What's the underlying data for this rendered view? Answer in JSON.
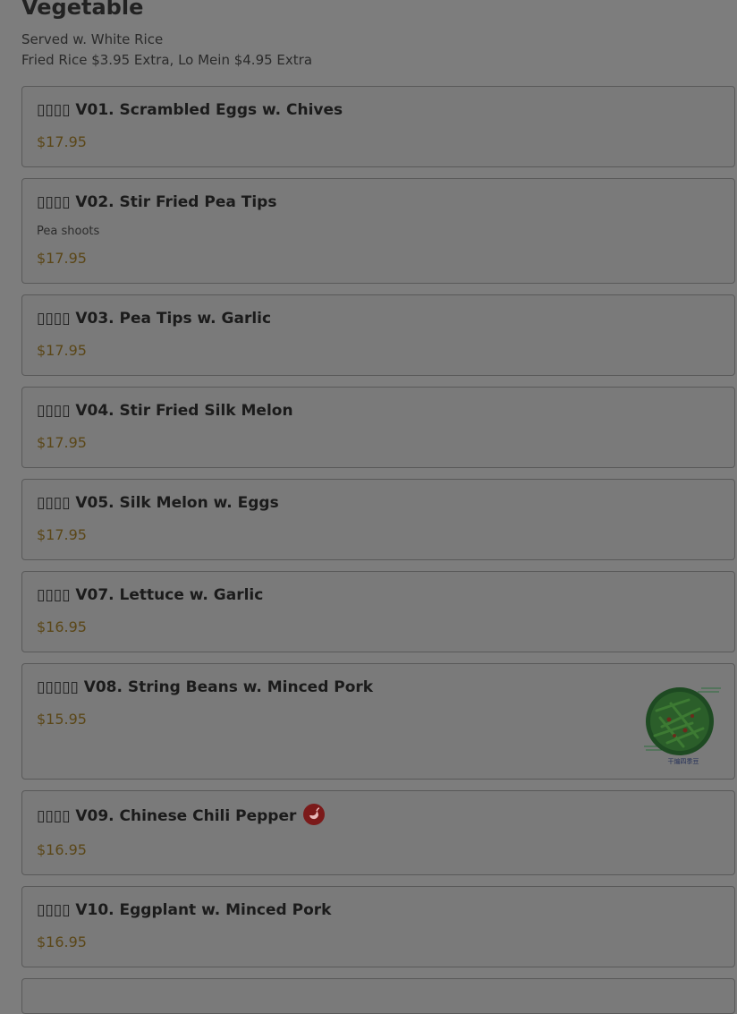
{
  "section": {
    "title": "Vegetable",
    "note_line1": "Served w. White Rice",
    "note_line2": "Fried Rice $3.95 Extra, Lo Mein $4.95 Extra"
  },
  "items": [
    {
      "title": "▯▯▯▯ V01. Scrambled Eggs w. Chives",
      "price": "$17.95"
    },
    {
      "title": "▯▯▯▯ V02. Stir Fried Pea Tips",
      "description": "Pea shoots",
      "price": "$17.95"
    },
    {
      "title": "▯▯▯▯ V03. Pea Tips w. Garlic",
      "price": "$17.95"
    },
    {
      "title": "▯▯▯▯ V04. Stir Fried Silk Melon",
      "price": "$17.95"
    },
    {
      "title": "▯▯▯▯ V05. Silk Melon w. Eggs",
      "price": "$17.95"
    },
    {
      "title": "▯▯▯▯ V07. Lettuce w. Garlic",
      "price": "$16.95"
    },
    {
      "title": "▯▯▯▯▯ V08. String Beans w. Minced Pork",
      "price": "$15.95",
      "image_caption": "干煸四季豆"
    },
    {
      "title": "▯▯▯▯ V09. Chinese Chili Pepper",
      "price": "$16.95",
      "badge_icon": "spicy-chili-icon"
    },
    {
      "title": "▯▯▯▯ V10. Eggplant w. Minced Pork",
      "price": "$16.95"
    }
  ],
  "colors": {
    "overlay_bg": "#7d7d7d",
    "price": "#5b4718",
    "spicy_badge": "#7b1a1a"
  }
}
